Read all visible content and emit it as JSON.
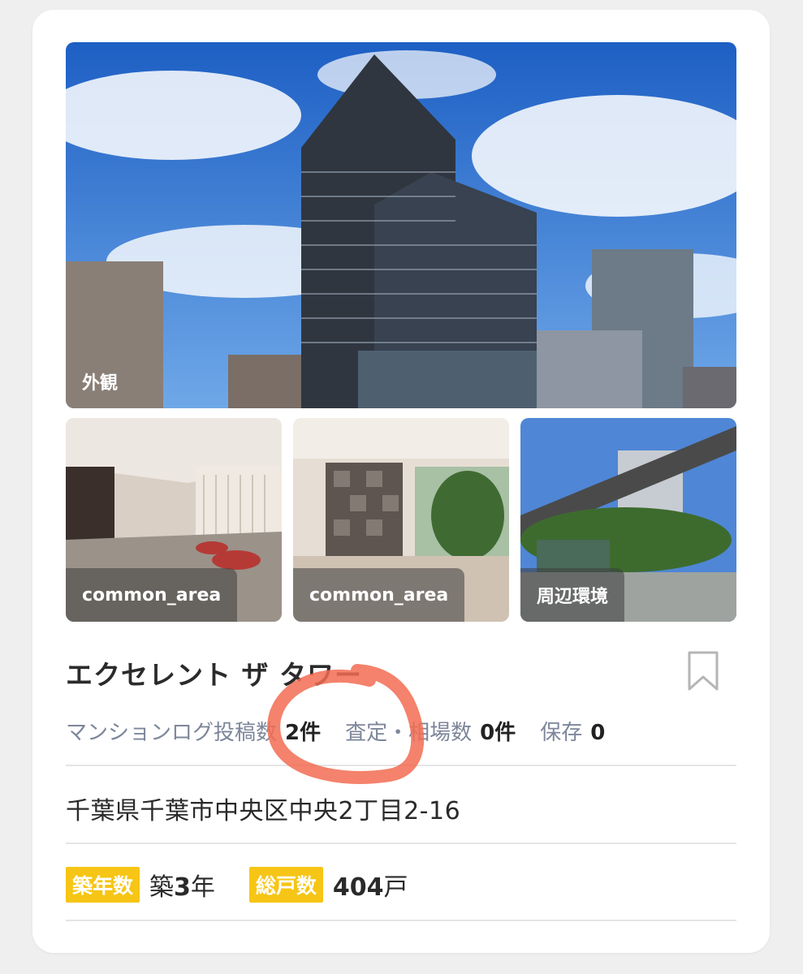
{
  "photos": {
    "main_label": "外観",
    "thumb1_label": "common_area",
    "thumb2_label": "common_area",
    "thumb3_label": "周辺環境"
  },
  "property": {
    "name": "エクセレント ザ タワー",
    "address": "千葉県千葉市中央区中央2丁目2-16"
  },
  "stats": {
    "posts_label": "マンションログ投稿数",
    "posts_value": "2件",
    "appraisal_label": "査定・相場数",
    "appraisal_value": "0件",
    "saved_label": "保存",
    "saved_value": "0"
  },
  "specs": {
    "age_label": "築年数",
    "age_prefix": "築",
    "age_num": "3",
    "age_unit": "年",
    "units_label": "総戸数",
    "units_num": "404",
    "units_unit": "戸"
  },
  "colors": {
    "badge": "#f6c515",
    "label_gray": "#7d869a",
    "annotation": "#f26c52"
  },
  "icons": {
    "bookmark": "bookmark-icon"
  }
}
